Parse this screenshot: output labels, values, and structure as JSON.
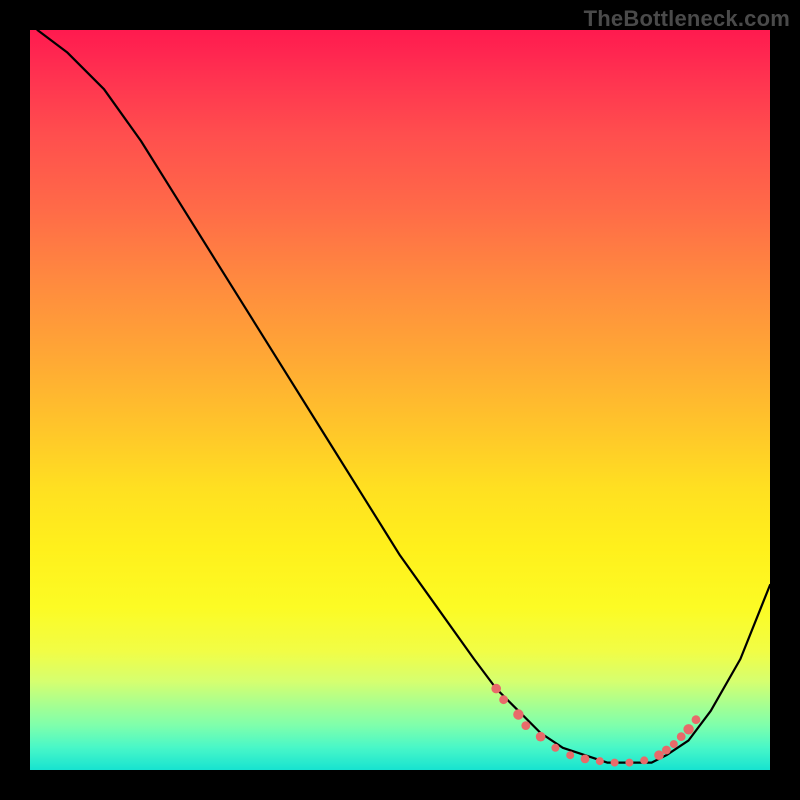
{
  "watermark": "TheBottleneck.com",
  "chart_data": {
    "type": "line",
    "title": "",
    "xlabel": "",
    "ylabel": "",
    "xlim": [
      0,
      100
    ],
    "ylim": [
      0,
      100
    ],
    "grid": false,
    "legend": false,
    "background": {
      "kind": "vertical-gradient",
      "top_color": "#ff1a4f",
      "bottom_color": "#17e3d0",
      "note": "red (high) to green (low) heatmap-style backdrop"
    },
    "series": [
      {
        "name": "curve",
        "x": [
          1,
          5,
          10,
          15,
          20,
          25,
          30,
          35,
          40,
          45,
          50,
          55,
          60,
          63,
          66,
          69,
          72,
          75,
          78,
          81,
          84,
          86,
          89,
          92,
          96,
          100
        ],
        "y": [
          100,
          97,
          92,
          85,
          77,
          69,
          61,
          53,
          45,
          37,
          29,
          22,
          15,
          11,
          8,
          5,
          3,
          2,
          1,
          1,
          1,
          2,
          4,
          8,
          15,
          25
        ]
      }
    ],
    "markers": {
      "name": "beads",
      "note": "small pink dots along the low-value basin of the curve",
      "points": [
        {
          "x": 63,
          "y": 11,
          "r": 1.2
        },
        {
          "x": 64,
          "y": 9.5,
          "r": 1.1
        },
        {
          "x": 66,
          "y": 7.5,
          "r": 1.3
        },
        {
          "x": 67,
          "y": 6,
          "r": 1.1
        },
        {
          "x": 69,
          "y": 4.5,
          "r": 1.2
        },
        {
          "x": 71,
          "y": 3,
          "r": 1.0
        },
        {
          "x": 73,
          "y": 2,
          "r": 1.0
        },
        {
          "x": 75,
          "y": 1.5,
          "r": 1.1
        },
        {
          "x": 77,
          "y": 1.2,
          "r": 1.0
        },
        {
          "x": 79,
          "y": 1,
          "r": 1.0
        },
        {
          "x": 81,
          "y": 1,
          "r": 1.0
        },
        {
          "x": 83,
          "y": 1.3,
          "r": 1.0
        },
        {
          "x": 85,
          "y": 2,
          "r": 1.2
        },
        {
          "x": 86,
          "y": 2.7,
          "r": 1.1
        },
        {
          "x": 87,
          "y": 3.5,
          "r": 1.0
        },
        {
          "x": 88,
          "y": 4.5,
          "r": 1.1
        },
        {
          "x": 89,
          "y": 5.5,
          "r": 1.3
        },
        {
          "x": 90,
          "y": 6.8,
          "r": 1.1
        }
      ]
    }
  }
}
